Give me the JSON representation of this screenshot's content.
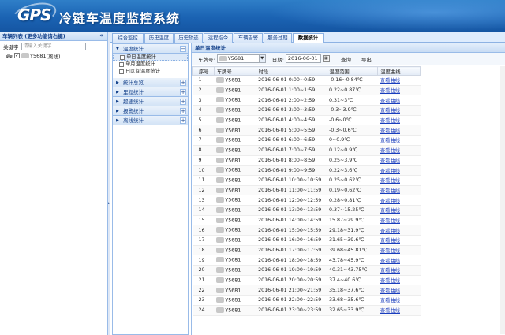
{
  "header": {
    "logo": "GPS",
    "title": "冷链车温度监控系统"
  },
  "left_panel": {
    "title": "车辆列表 (更多功能请右键)",
    "search_label": "关键字",
    "search_placeholder": "请输入关键字",
    "vehicle": {
      "plate": "Y5681",
      "status": "(离线)"
    }
  },
  "tabs": [
    {
      "label": "综合监控",
      "active": false
    },
    {
      "label": "历史温度",
      "active": false
    },
    {
      "label": "历史轨迹",
      "active": false
    },
    {
      "label": "远程指令",
      "active": false
    },
    {
      "label": "车辆告警",
      "active": false
    },
    {
      "label": "服务过期",
      "active": false
    },
    {
      "label": "数据统计",
      "active": true
    }
  ],
  "nav": {
    "groups": [
      {
        "label": "温度统计",
        "expanded": true,
        "items": [
          "单日温度统计",
          "单月温度统计",
          "日区间温度统计"
        ],
        "selected": 0
      },
      {
        "label": "统计总览",
        "expanded": false
      },
      {
        "label": "里程统计",
        "expanded": false
      },
      {
        "label": "超速统计",
        "expanded": false
      },
      {
        "label": "报警统计",
        "expanded": false
      },
      {
        "label": "离线统计",
        "expanded": false
      }
    ]
  },
  "main": {
    "title": "单日温度统计",
    "toolbar": {
      "plate_label": "车牌号:",
      "plate_value": "Y5681",
      "date_label": "日期:",
      "date_value": "2016-06-01",
      "query_button": "查询",
      "export_button": "导出"
    },
    "columns": [
      "序号",
      "车牌号",
      "时段",
      "温度范围",
      "温度曲线"
    ],
    "curve_link": "查看曲线",
    "rows": [
      {
        "no": "1",
        "plate": "Y5681",
        "period": "2016-06-01 0:00~0:59",
        "range": "-0.16~0.84℃"
      },
      {
        "no": "2",
        "plate": "Y5681",
        "period": "2016-06-01 1:00~1:59",
        "range": "0.22~0.87℃"
      },
      {
        "no": "3",
        "plate": "Y5681",
        "period": "2016-06-01 2:00~2:59",
        "range": "0.31~3℃"
      },
      {
        "no": "4",
        "plate": "Y5681",
        "period": "2016-06-01 3:00~3:59",
        "range": "-0.3~3.9℃"
      },
      {
        "no": "5",
        "plate": "Y5681",
        "period": "2016-06-01 4:00~4:59",
        "range": "-0.6~0℃"
      },
      {
        "no": "6",
        "plate": "Y5681",
        "period": "2016-06-01 5:00~5:59",
        "range": "-0.3~0.6℃"
      },
      {
        "no": "7",
        "plate": "Y5681",
        "period": "2016-06-01 6:00~6:59",
        "range": "0~0.9℃"
      },
      {
        "no": "8",
        "plate": "Y5681",
        "period": "2016-06-01 7:00~7:59",
        "range": "0.12~0.9℃"
      },
      {
        "no": "9",
        "plate": "Y5681",
        "period": "2016-06-01 8:00~8:59",
        "range": "0.25~3.9℃"
      },
      {
        "no": "10",
        "plate": "Y5681",
        "period": "2016-06-01 9:00~9:59",
        "range": "0.22~3.6℃"
      },
      {
        "no": "11",
        "plate": "Y5681",
        "period": "2016-06-01 10:00~10:59",
        "range": "0.25~0.62℃"
      },
      {
        "no": "12",
        "plate": "Y5681",
        "period": "2016-06-01 11:00~11:59",
        "range": "0.19~0.62℃"
      },
      {
        "no": "13",
        "plate": "Y5681",
        "period": "2016-06-01 12:00~12:59",
        "range": "0.28~0.81℃"
      },
      {
        "no": "14",
        "plate": "Y5681",
        "period": "2016-06-01 13:00~13:59",
        "range": "0.37~15.25℃"
      },
      {
        "no": "15",
        "plate": "Y5681",
        "period": "2016-06-01 14:00~14:59",
        "range": "15.87~29.9℃"
      },
      {
        "no": "16",
        "plate": "Y5681",
        "period": "2016-06-01 15:00~15:59",
        "range": "29.18~31.9℃"
      },
      {
        "no": "17",
        "plate": "Y5681",
        "period": "2016-06-01 16:00~16:59",
        "range": "31.65~39.6℃"
      },
      {
        "no": "18",
        "plate": "Y5681",
        "period": "2016-06-01 17:00~17:59",
        "range": "39.68~45.81℃"
      },
      {
        "no": "19",
        "plate": "Y5681",
        "period": "2016-06-01 18:00~18:59",
        "range": "43.78~45.9℃"
      },
      {
        "no": "20",
        "plate": "Y5681",
        "period": "2016-06-01 19:00~19:59",
        "range": "40.31~43.75℃"
      },
      {
        "no": "21",
        "plate": "Y5681",
        "period": "2016-06-01 20:00~20:59",
        "range": "37.4~40.6℃"
      },
      {
        "no": "22",
        "plate": "Y5681",
        "period": "2016-06-01 21:00~21:59",
        "range": "35.18~37.6℃"
      },
      {
        "no": "23",
        "plate": "Y5681",
        "period": "2016-06-01 22:00~22:59",
        "range": "33.68~35.6℃"
      },
      {
        "no": "24",
        "plate": "Y5681",
        "period": "2016-06-01 23:00~23:59",
        "range": "32.65~33.9℃"
      }
    ]
  }
}
